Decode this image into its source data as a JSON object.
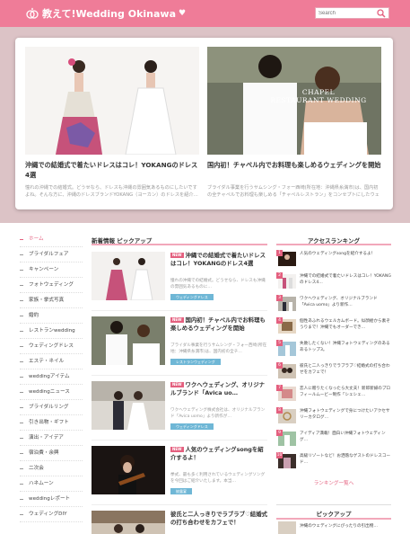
{
  "header": {
    "site_title": "教えて!Wedding Okinawa",
    "search_placeholder": "Search"
  },
  "hero": [
    {
      "title": "沖縄での結婚式で着たいドレスはコレ！YOKANGのドレス4選",
      "desc": "憧れの沖縄での結婚式。どうせなら、ドレスも沖縄の雰囲気あるものにしたいですよね。そんな方に、沖縄のドレスブランドYOKANG（ヨーカン）のドレスを紹介…"
    },
    {
      "title": "国内初！チャペル内でお料理も楽しめるウェディングを開始",
      "desc": "ブライダル事業を行うサムシング・フォー西崎(所在地：沖縄県糸満市)は、国内初の全チャペルでお料理も楽しめる「チャペルレストラン」をコンセプトにしたウェディ…"
    },
    {
      "overlay": "CHAPEL\nRESTAURANT WEDDING"
    }
  ],
  "nav": [
    "ホーム",
    "ブライダルフェア",
    "キャンペーン",
    "フォトウェディング",
    "家族・挙式写真",
    "婚約",
    "レストランwedding",
    "ウェディングドレス",
    "エステ・ネイル",
    "weddingアイテム",
    "weddingニュース",
    "ブライダルリング",
    "引き出物・ギフト",
    "演出・アイデア",
    "宿泊費・余興",
    "二次会",
    "ハネムーン",
    "weddingレポート",
    "ウェディングDIY"
  ],
  "main": {
    "heading": "新着情報 ピックアップ",
    "new_label": "NEW",
    "posts": [
      {
        "title": "沖縄での結婚式で着たいドレスはコレ！YOKANGのドレス4選",
        "desc": "憧れの沖縄での結婚式。どうせなら、ドレスも沖縄の雰囲気あるものに…",
        "tag": "ウェディングドレス"
      },
      {
        "title": "国内初！チャペル内でお料理も楽しめるウェディングを開始",
        "desc": "ブライダル事業を行うサムシング・フォー西崎(所在地：沖縄県糸満市)は、国内初の全チ…",
        "tag": "レストランウェディング"
      },
      {
        "title": "ワクへウェディング、オリジナルブランド「Avica uo…",
        "desc": "ワクへウェディング株式会社は、オリジナルブランド「Avica uomo」より新作が…",
        "tag": "ウェディングドレス"
      },
      {
        "title": "人気のウェディングsongを紹介するよ！",
        "desc": "挙式、最も多く利用されているウェディングソングを今回はご紹介いたします。本当…",
        "tag": "披露宴"
      },
      {
        "title": "彼氏と二人っきりでラブラブ♡結婚式の打ち合わせをカフェで！",
        "desc": "",
        "tag": ""
      }
    ]
  },
  "ranking": {
    "heading": "アクセスランキング",
    "items": [
      {
        "num": "1",
        "text": "人気のウェディングsongを紹介するよ！"
      },
      {
        "num": "2",
        "text": "沖縄での結婚式で着たいドレスはコレ！YOKANGのドレス4…"
      },
      {
        "num": "3",
        "text": "ワクへウェディング、オリジナルブランド「Avica uomo」より新作…"
      },
      {
        "num": "4",
        "text": "個性あふれるウェルカムボード。似顔絵から素ぞうりまで！沖縄でもオーダーでき…"
      },
      {
        "num": "5",
        "text": "失敗したくない！沖縄フォトウェディングのあるあるトップ3。"
      },
      {
        "num": "6",
        "text": "彼氏と二人っきりでラブラブ♡結婚式の打ち合わせをカフェで！"
      },
      {
        "num": "7",
        "text": "恋人に贈りたくなったら大丈夫！新郎新婦のプロフィールムービー制作「シェシェ…"
      },
      {
        "num": "8",
        "text": "沖縄フォトウェディングで身につけたいアクセサリーカタログ…"
      },
      {
        "num": "9",
        "text": "アイディア満載！面白い沖縄フォトウェディング…"
      },
      {
        "num": "10",
        "text": "高級リゾートなど！お洒落なゲストのドレスコード…"
      }
    ],
    "more": "ランキング一覧へ"
  },
  "pickup": {
    "heading": "ピックアップ",
    "first": "沖縄のウェディングにぴったりの引出物…"
  }
}
